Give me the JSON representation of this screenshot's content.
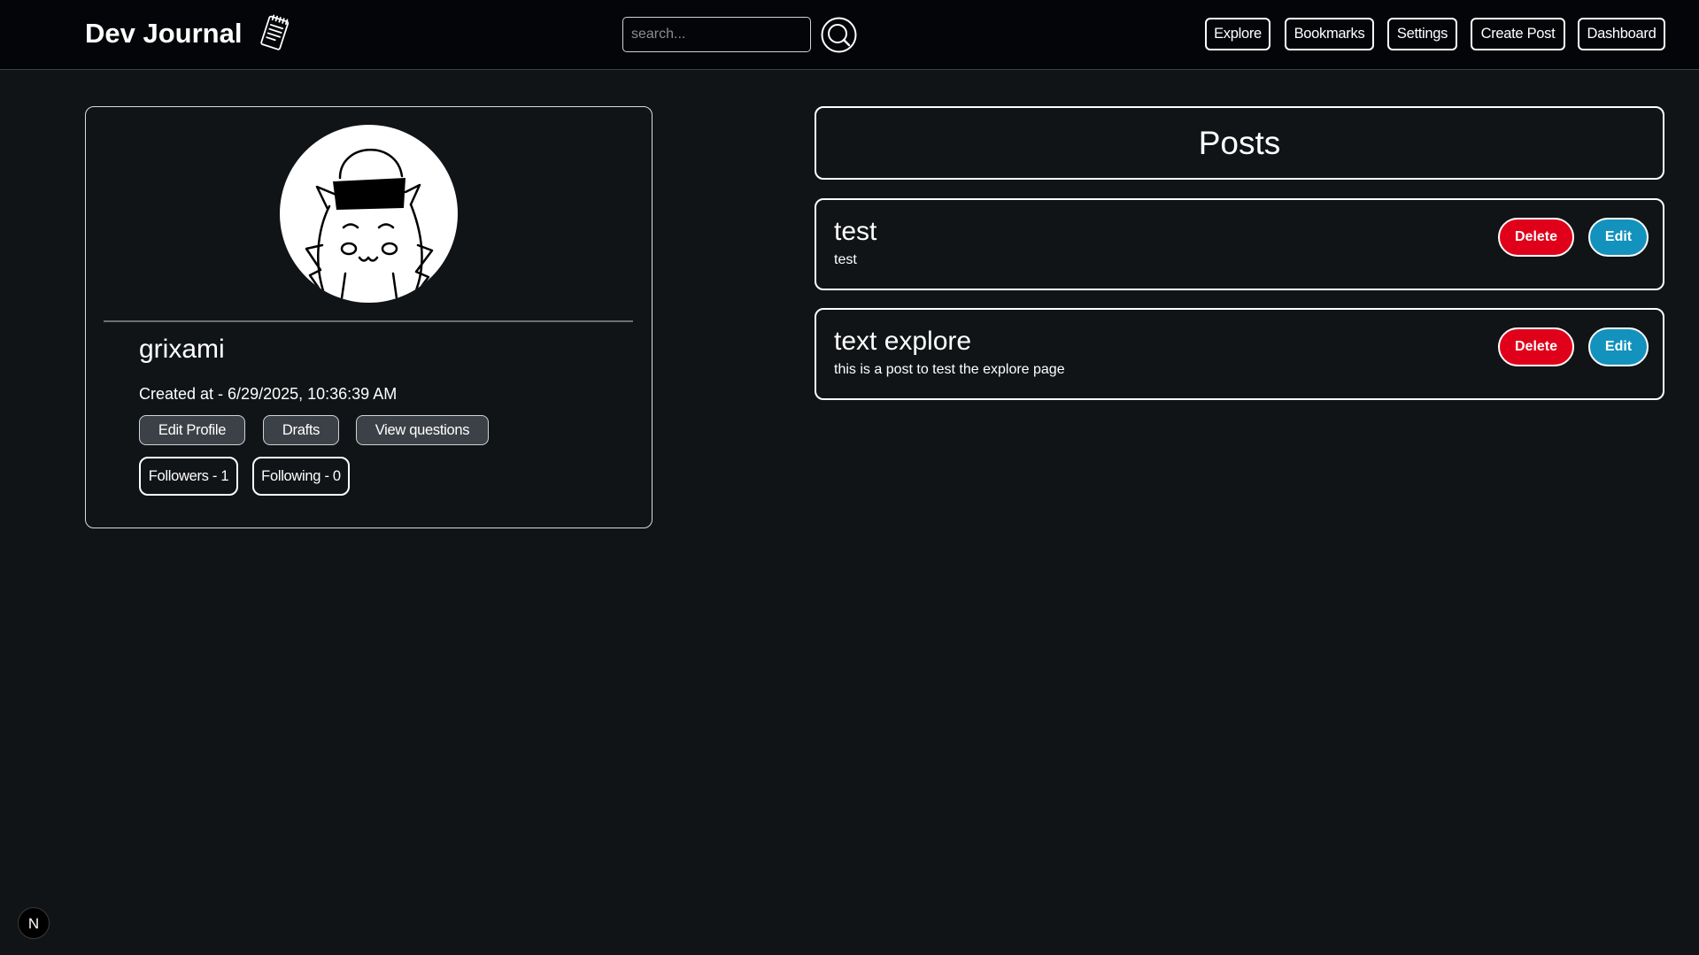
{
  "header": {
    "brand": "Dev Journal",
    "brand_icon": "notepad-icon",
    "search": {
      "placeholder": "search...",
      "value": "",
      "icon": "search-icon"
    },
    "nav": [
      "Explore",
      "Bookmarks",
      "Settings",
      "Create Post",
      "Dashboard"
    ]
  },
  "profile": {
    "avatar_icon": "avatar",
    "username": "grixami",
    "created_at": "Created at - 6/29/2025, 10:36:39 AM",
    "actions": [
      "Edit Profile",
      "Drafts",
      "View questions"
    ],
    "followers_label": "Followers - 1",
    "following_label": "Following - 0"
  },
  "posts": {
    "heading": "Posts",
    "items": [
      {
        "title": "test",
        "body": "test",
        "delete_label": "Delete",
        "edit_label": "Edit"
      },
      {
        "title": "text explore",
        "body": "this is a post to test the explore page",
        "delete_label": "Delete",
        "edit_label": "Edit"
      }
    ]
  },
  "dev_indicator": {
    "label": "N",
    "icon": "nextjs-logo-icon"
  },
  "colors": {
    "page_background": "#111416",
    "header_background": "#030508",
    "delete": "#e0001a",
    "edit": "#1392bd",
    "secondary_button": "#3c4148"
  }
}
